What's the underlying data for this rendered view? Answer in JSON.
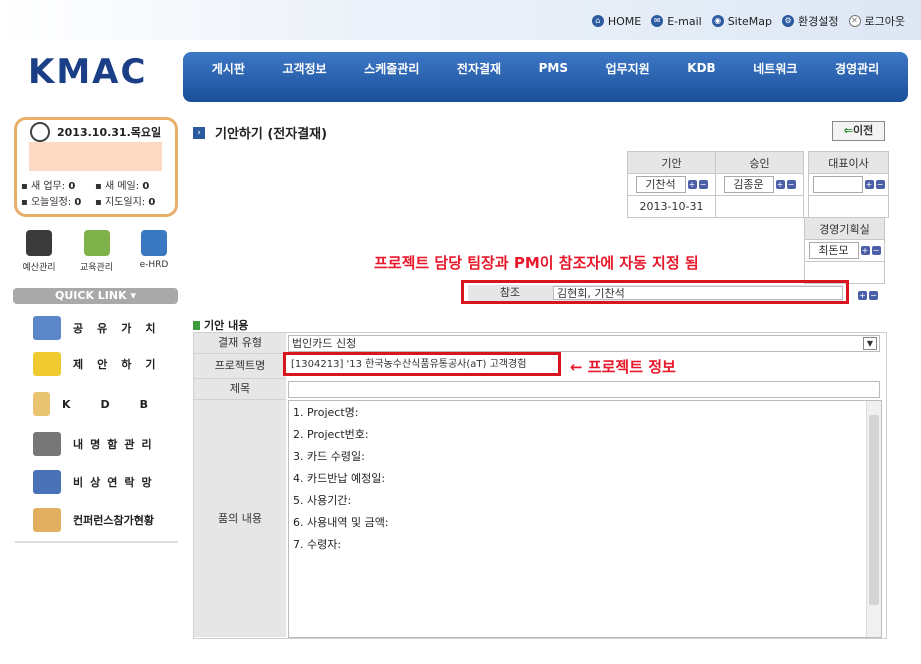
{
  "top_links": [
    {
      "label": "HOME",
      "icon": "home-icon"
    },
    {
      "label": "E-mail",
      "icon": "mail-icon"
    },
    {
      "label": "SiteMap",
      "icon": "sitemap-icon"
    },
    {
      "label": "환경설정",
      "icon": "settings-icon"
    },
    {
      "label": "로그아웃",
      "icon": "logout-icon"
    }
  ],
  "logo": "KMAC",
  "main_nav": [
    "게시판",
    "고객정보",
    "스케줄관리",
    "전자결재",
    "PMS",
    "업무지원",
    "KDB",
    "네트워크",
    "경영관리"
  ],
  "datebox": {
    "date": "2013.10.31.목요일",
    "stats": [
      {
        "label": "새 업무:",
        "value": "0"
      },
      {
        "label": "새 메일:",
        "value": "0"
      },
      {
        "label": "오늘일정:",
        "value": "0"
      },
      {
        "label": "지도일지:",
        "value": "0"
      }
    ]
  },
  "quick_icons": [
    {
      "label": "예산관리",
      "color": "#3b3b3b"
    },
    {
      "label": "교육관리",
      "color": "#7fb24a"
    },
    {
      "label": "e-HRD",
      "color": "#3a78c2"
    }
  ],
  "quick_link": "QUICK LINK",
  "menu": [
    {
      "label": "공유가치",
      "icon": "share-icon"
    },
    {
      "label": "제안하기",
      "icon": "idea-bulb-icon"
    },
    {
      "label": "KDB",
      "icon": "folder-icon"
    },
    {
      "label": "내명함관리",
      "icon": "business-card-icon"
    },
    {
      "label": "비상연락망",
      "icon": "phone-icon"
    },
    {
      "label": "컨퍼런스참가현황",
      "icon": "conference-icon"
    }
  ],
  "page": {
    "title": "기안하기 (전자결재)",
    "prev_label": "이전"
  },
  "approval": {
    "headers": [
      "기안",
      "승인",
      "대표이사"
    ],
    "drafter": "기찬석",
    "approver": "김종운",
    "ceo": "",
    "date": "2013-10-31",
    "planning_header": "경영기획실",
    "planning_name": "최돈모"
  },
  "annotation_reference": "프로젝트 담당 팀장과 PM이 참조자에 자동 지정 됨",
  "reference": {
    "label": "참조",
    "value": "김현회, 기찬석"
  },
  "section_title": "기안 내용",
  "form": {
    "type_label": "결재 유형",
    "type_value": "법인카드 신청",
    "project_label": "프로젝트명",
    "project_value": "[1304213] '13 한국농수산식품유통공사(aT) 고객경험",
    "title_label": "제목",
    "title_value": "",
    "body_label": "품의 내용",
    "body_lines": [
      "1. Project명:",
      "2. Project번호:",
      "3. 카드 수령일:",
      "4. 카드반납 예정일:",
      "5. 사용기간:",
      "6. 사용내역 및 금액:",
      "7. 수령자:"
    ]
  },
  "annotation_project": "← 프로젝트 정보"
}
